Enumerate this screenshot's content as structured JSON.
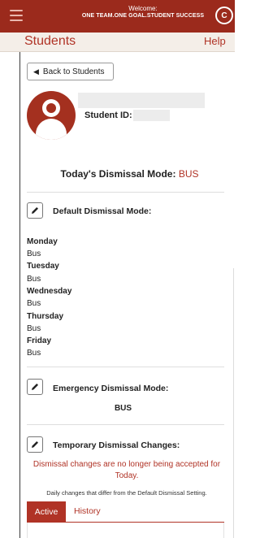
{
  "header": {
    "welcome_line1": "Welcome:",
    "welcome_line2": "ONE TEAM.ONE GOAL.STUDENT SUCCESS",
    "logo_letter": "C"
  },
  "nav": {
    "title": "Students",
    "help": "Help"
  },
  "student": {
    "back_label": "Back to Students",
    "id_label": "Student ID:"
  },
  "today": {
    "label": "Today's Dismissal Mode:",
    "mode": "BUS"
  },
  "default_mode": {
    "label": "Default Dismissal Mode:",
    "days": [
      {
        "day": "Monday",
        "mode": "Bus"
      },
      {
        "day": "Tuesday",
        "mode": "Bus"
      },
      {
        "day": "Wednesday",
        "mode": "Bus"
      },
      {
        "day": "Thursday",
        "mode": "Bus"
      },
      {
        "day": "Friday",
        "mode": "Bus"
      }
    ]
  },
  "emergency": {
    "label": "Emergency Dismissal Mode:",
    "mode": "BUS"
  },
  "temporary": {
    "label": "Temporary Dismissal Changes:",
    "notice": "Dismissal changes are no longer being accepted for Today.",
    "note": "Daily changes that differ from the Default Dismissal Setting.",
    "tabs": [
      "Active",
      "History"
    ]
  },
  "colors": {
    "brand": "#9b2a1c",
    "accent": "#b03326"
  }
}
